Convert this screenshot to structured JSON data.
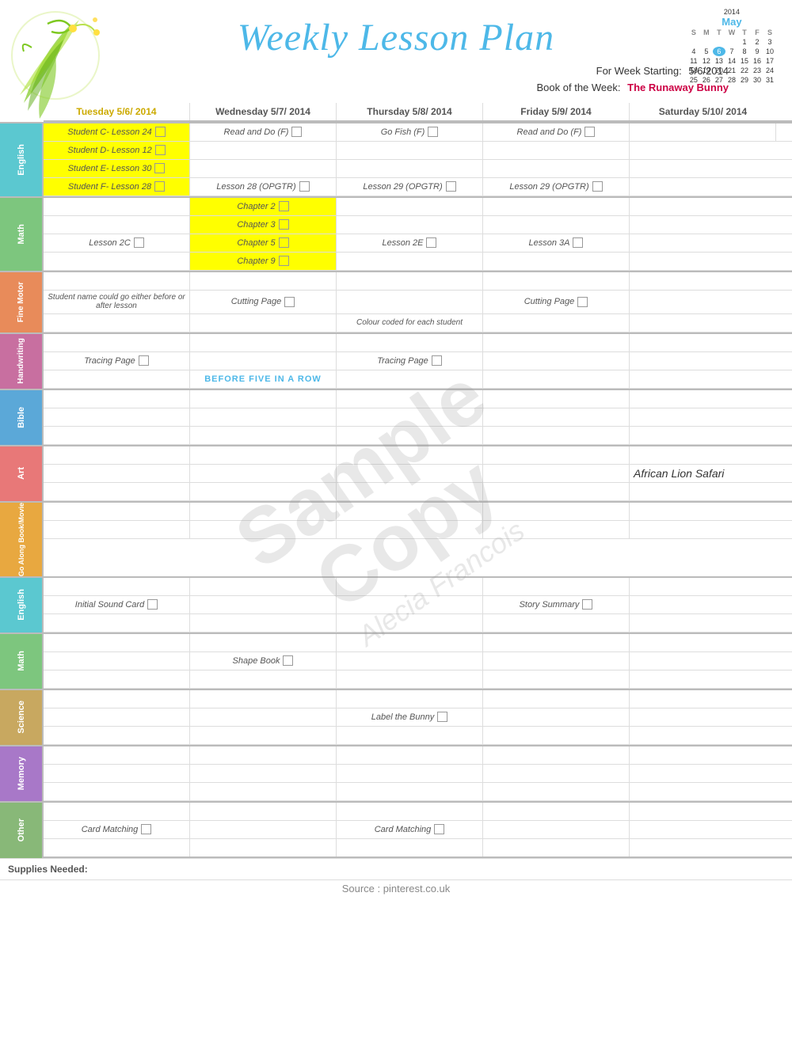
{
  "title": "Weekly Lesson Plan",
  "week_starting_label": "For Week Starting:",
  "week_starting_value": "5/6/2014",
  "book_label": "Book of the Week:",
  "book_value": "The Runaway Bunny",
  "calendar": {
    "year": "2014",
    "month": "May",
    "headers": [
      "S",
      "M",
      "T",
      "W",
      "T",
      "F",
      "S"
    ],
    "rows": [
      [
        "",
        "",
        "",
        "",
        "1",
        "2",
        "3"
      ],
      [
        "4",
        "5",
        "6",
        "7",
        "8",
        "9",
        "10"
      ],
      [
        "11",
        "12",
        "13",
        "14",
        "15",
        "16",
        "17"
      ],
      [
        "18",
        "19",
        "20",
        "21",
        "22",
        "23",
        "24"
      ],
      [
        "25",
        "26",
        "27",
        "28",
        "29",
        "30",
        "31"
      ]
    ],
    "today_col": 2,
    "today_row": 1
  },
  "columns": {
    "tue": "Tuesday 5/6/ 2014",
    "wed": "Wednesday 5/7/ 2014",
    "thu": "Thursday 5/8/ 2014",
    "fri": "Friday 5/9/ 2014",
    "sat": "Saturday 5/10/ 2014"
  },
  "subjects": {
    "english": "English",
    "math": "Math",
    "fine_motor": "Fine Motor",
    "handwriting": "Handwriting",
    "bible": "Bible",
    "art": "Art",
    "go_along": "Go Along Book/Movie",
    "english2": "English",
    "math2": "Math",
    "science": "Science",
    "memory": "Memory",
    "other": "Other"
  },
  "english_rows": [
    {
      "tue": "Student C- Lesson 24",
      "wed": "Read and Do (F)",
      "thu": "Go Fish (F)",
      "fri": "Read and Do (F)"
    },
    {
      "tue": "Student D- Lesson 12",
      "wed": "",
      "thu": "",
      "fri": ""
    },
    {
      "tue": "Student E- Lesson 30",
      "wed": "",
      "thu": "",
      "fri": ""
    },
    {
      "tue": "Student F-  Lesson 28",
      "wed": "Lesson 28 (OPGTR)",
      "thu": "Lesson 29 (OPGTR)",
      "fri": "Lesson 29 (OPGTR)"
    }
  ],
  "math_rows": [
    {
      "tue": "",
      "wed": "Chapter 2",
      "thu": "",
      "fri": "",
      "wed_yellow": true
    },
    {
      "tue": "",
      "wed": "Chapter 3",
      "thu": "",
      "fri": "",
      "wed_yellow": true
    },
    {
      "tue": "Lesson 2C",
      "wed": "Chapter 5",
      "thu": "Lesson 2E",
      "fri": "Lesson 3A",
      "wed_yellow": true
    },
    {
      "tue": "",
      "wed": "Chapter 9",
      "thu": "",
      "fri": "",
      "wed_yellow": true
    }
  ],
  "fine_motor_rows": [
    {
      "tue": "",
      "wed": "",
      "thu": "",
      "fri": ""
    },
    {
      "tue": "Student name could go either before or after lesson",
      "wed": "Cutting Page",
      "thu": "",
      "fri": "Cutting Page"
    },
    {
      "tue": "",
      "wed": "",
      "thu": "Colour coded for each student",
      "fri": ""
    }
  ],
  "handwriting_rows": [
    {
      "tue": "",
      "wed": "",
      "thu": "",
      "fri": ""
    },
    {
      "tue": "Tracing Page",
      "wed": "",
      "thu": "Tracing Page",
      "fri": ""
    },
    {
      "tue": "",
      "wed": "BEFORE FIVE IN A ROW",
      "thu": "",
      "fri": "",
      "wed_blue": true
    }
  ],
  "bible_rows": [
    {
      "tue": "",
      "wed": "",
      "thu": "",
      "fri": ""
    },
    {
      "tue": "",
      "wed": "",
      "thu": "",
      "fri": ""
    },
    {
      "tue": "",
      "wed": "",
      "thu": "",
      "fri": ""
    }
  ],
  "art_rows": [
    {
      "tue": "",
      "wed": "",
      "thu": "",
      "fri": ""
    },
    {
      "tue": "",
      "wed": "",
      "thu": "",
      "fri": "",
      "sat": "African Lion Safari"
    },
    {
      "tue": "",
      "wed": "",
      "thu": "",
      "fri": ""
    }
  ],
  "goalong_rows": [
    {
      "tue": "",
      "wed": "",
      "thu": "",
      "fri": ""
    },
    {
      "tue": "",
      "wed": "",
      "thu": "",
      "fri": ""
    }
  ],
  "english2_rows": [
    {
      "tue": "",
      "wed": "",
      "thu": "",
      "fri": ""
    },
    {
      "tue": "Initial Sound Card",
      "wed": "",
      "thu": "",
      "fri": "Story Summary"
    },
    {
      "tue": "",
      "wed": "",
      "thu": "",
      "fri": ""
    }
  ],
  "math2_rows": [
    {
      "tue": "",
      "wed": "",
      "thu": "",
      "fri": ""
    },
    {
      "tue": "",
      "wed": "Shape Book",
      "thu": "",
      "fri": ""
    },
    {
      "tue": "",
      "wed": "",
      "thu": "",
      "fri": ""
    }
  ],
  "science_rows": [
    {
      "tue": "",
      "wed": "",
      "thu": "",
      "fri": ""
    },
    {
      "tue": "",
      "wed": "",
      "thu": "Label the Bunny",
      "fri": ""
    },
    {
      "tue": "",
      "wed": "",
      "thu": "",
      "fri": ""
    }
  ],
  "memory_rows": [
    {
      "tue": "",
      "wed": "",
      "thu": "",
      "fri": ""
    },
    {
      "tue": "",
      "wed": "",
      "thu": "",
      "fri": ""
    },
    {
      "tue": "",
      "wed": "",
      "thu": "",
      "fri": ""
    }
  ],
  "other_rows": [
    {
      "tue": "",
      "wed": "",
      "thu": "",
      "fri": ""
    },
    {
      "tue": "Card Matching",
      "wed": "",
      "thu": "Card Matching",
      "fri": ""
    },
    {
      "tue": "",
      "wed": "",
      "thu": "",
      "fri": ""
    }
  ],
  "supplies_label": "Supplies Needed:",
  "source_label": "Source : pinterest.co.uk",
  "watermark_line1": "Sample",
  "watermark_line2": "Copy",
  "watermark_author": "Alecia Francois"
}
